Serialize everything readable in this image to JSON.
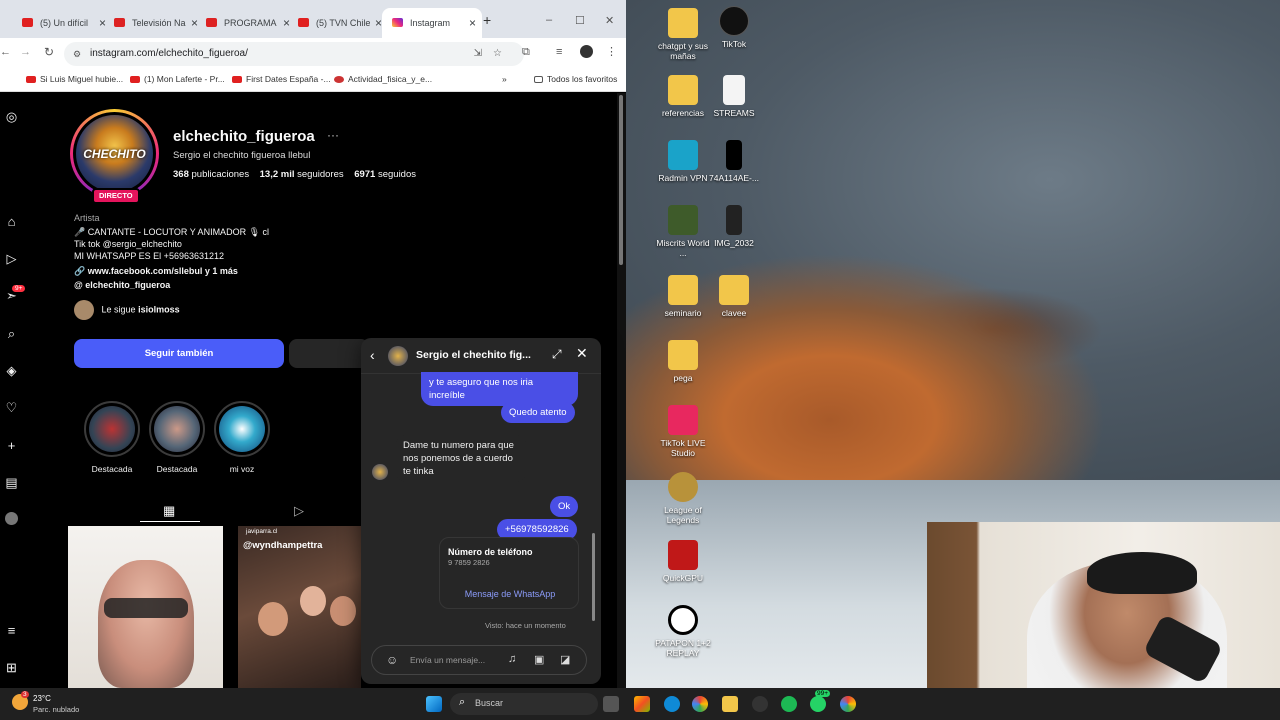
{
  "browser": {
    "tabs": [
      {
        "label": "(5) Un difícil",
        "active": false
      },
      {
        "label": "Televisión Na",
        "active": false
      },
      {
        "label": "PROGRAMA",
        "active": false
      },
      {
        "label": "(5) TVN Chile",
        "active": false
      },
      {
        "label": "Instagram",
        "active": true
      }
    ],
    "new_tab": "+",
    "url": "instagram.com/elchechito_figueroa/",
    "bookmarks": [
      "Si Luis Miguel hubie...",
      "(1) Mon Laferte - Pr...",
      "First Dates España -...",
      "Actividad_fisica_y_e..."
    ],
    "bookmarks_more": "»",
    "all_favorites": "Todos los favoritos"
  },
  "profile": {
    "username": "elchechito_figueroa",
    "more": "···",
    "full_name": "Sergio el chechito figueroa llebul",
    "live_badge": "DIRECTO",
    "avatar_text": "CHECHITO",
    "stats": {
      "posts_num": "368",
      "posts_label": "publicaciones",
      "followers_num": "13,2 mil",
      "followers_label": "seguidores",
      "following_num": "6971",
      "following_label": "seguidos"
    },
    "category": "Artista",
    "bio_lines": [
      "🎤 CANTANTE - LOCUTOR Y ANIMADOR 🎙 cl",
      "Tik tok @sergio_elchechito",
      "MI WHATSAPP ES El +56963631212"
    ],
    "link": "www.facebook.com/sllebul y 1 más",
    "threads": "elchechito_figueroa",
    "followed_by_prefix": "Le sigue",
    "followed_by_user": "isiolmoss",
    "follow_button": "Seguir también",
    "highlights": [
      "Destacada",
      "Destacada",
      "mi voz"
    ]
  },
  "chat": {
    "title": "Sergio el chechito fig...",
    "messages": {
      "partial": "y te aseguro que nos iria increíble",
      "m1": "Quedo atento",
      "m2": "Dame tu numero para que nos ponemos de a cuerdo te tinka",
      "m3": "Ok",
      "m4": "+56978592826"
    },
    "card_title": "Número de teléfono",
    "card_number": "9 7859 2826",
    "card_action": "Mensaje de WhatsApp",
    "seen": "Visto: hace un momento",
    "input_placeholder": "Envía un mensaje..."
  },
  "desktop_icons": [
    "chatgpt y sus mañas",
    "TikTok",
    "referencias",
    "STREAMS",
    "Radmin VPN",
    "74A114AE-...",
    "Miscrits World ...",
    "IMG_2032",
    "seminario",
    "clavee",
    "pega",
    "TikTok LIVE Studio",
    "League of Legends",
    "QuickGPU",
    "PATAPON 1+2 REPLAY"
  ],
  "posts": [
    {
      "user": ""
    },
    {
      "user": "javiparra.cl",
      "caption": "@wyndhampettra"
    }
  ],
  "taskbar": {
    "temperature": "23°C",
    "weather": "Parc. nublado",
    "search": "Buscar",
    "badge": "99+",
    "weather_badge": "3"
  },
  "colors": {
    "accent": "#4a5df9",
    "bubble": "#4a4fe6",
    "live": "#e4145c"
  }
}
